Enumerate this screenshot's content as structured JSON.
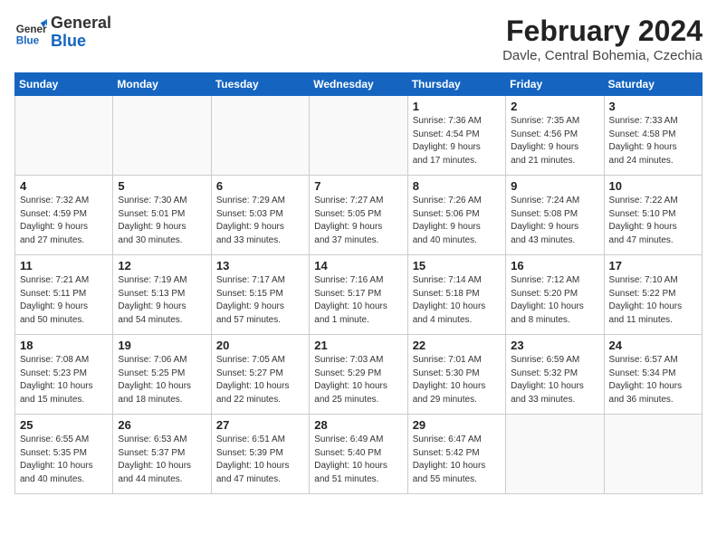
{
  "header": {
    "logo_general": "General",
    "logo_blue": "Blue",
    "month_year": "February 2024",
    "location": "Davle, Central Bohemia, Czechia"
  },
  "weekdays": [
    "Sunday",
    "Monday",
    "Tuesday",
    "Wednesday",
    "Thursday",
    "Friday",
    "Saturday"
  ],
  "weeks": [
    [
      {
        "day": "",
        "info": ""
      },
      {
        "day": "",
        "info": ""
      },
      {
        "day": "",
        "info": ""
      },
      {
        "day": "",
        "info": ""
      },
      {
        "day": "1",
        "info": "Sunrise: 7:36 AM\nSunset: 4:54 PM\nDaylight: 9 hours\nand 17 minutes."
      },
      {
        "day": "2",
        "info": "Sunrise: 7:35 AM\nSunset: 4:56 PM\nDaylight: 9 hours\nand 21 minutes."
      },
      {
        "day": "3",
        "info": "Sunrise: 7:33 AM\nSunset: 4:58 PM\nDaylight: 9 hours\nand 24 minutes."
      }
    ],
    [
      {
        "day": "4",
        "info": "Sunrise: 7:32 AM\nSunset: 4:59 PM\nDaylight: 9 hours\nand 27 minutes."
      },
      {
        "day": "5",
        "info": "Sunrise: 7:30 AM\nSunset: 5:01 PM\nDaylight: 9 hours\nand 30 minutes."
      },
      {
        "day": "6",
        "info": "Sunrise: 7:29 AM\nSunset: 5:03 PM\nDaylight: 9 hours\nand 33 minutes."
      },
      {
        "day": "7",
        "info": "Sunrise: 7:27 AM\nSunset: 5:05 PM\nDaylight: 9 hours\nand 37 minutes."
      },
      {
        "day": "8",
        "info": "Sunrise: 7:26 AM\nSunset: 5:06 PM\nDaylight: 9 hours\nand 40 minutes."
      },
      {
        "day": "9",
        "info": "Sunrise: 7:24 AM\nSunset: 5:08 PM\nDaylight: 9 hours\nand 43 minutes."
      },
      {
        "day": "10",
        "info": "Sunrise: 7:22 AM\nSunset: 5:10 PM\nDaylight: 9 hours\nand 47 minutes."
      }
    ],
    [
      {
        "day": "11",
        "info": "Sunrise: 7:21 AM\nSunset: 5:11 PM\nDaylight: 9 hours\nand 50 minutes."
      },
      {
        "day": "12",
        "info": "Sunrise: 7:19 AM\nSunset: 5:13 PM\nDaylight: 9 hours\nand 54 minutes."
      },
      {
        "day": "13",
        "info": "Sunrise: 7:17 AM\nSunset: 5:15 PM\nDaylight: 9 hours\nand 57 minutes."
      },
      {
        "day": "14",
        "info": "Sunrise: 7:16 AM\nSunset: 5:17 PM\nDaylight: 10 hours\nand 1 minute."
      },
      {
        "day": "15",
        "info": "Sunrise: 7:14 AM\nSunset: 5:18 PM\nDaylight: 10 hours\nand 4 minutes."
      },
      {
        "day": "16",
        "info": "Sunrise: 7:12 AM\nSunset: 5:20 PM\nDaylight: 10 hours\nand 8 minutes."
      },
      {
        "day": "17",
        "info": "Sunrise: 7:10 AM\nSunset: 5:22 PM\nDaylight: 10 hours\nand 11 minutes."
      }
    ],
    [
      {
        "day": "18",
        "info": "Sunrise: 7:08 AM\nSunset: 5:23 PM\nDaylight: 10 hours\nand 15 minutes."
      },
      {
        "day": "19",
        "info": "Sunrise: 7:06 AM\nSunset: 5:25 PM\nDaylight: 10 hours\nand 18 minutes."
      },
      {
        "day": "20",
        "info": "Sunrise: 7:05 AM\nSunset: 5:27 PM\nDaylight: 10 hours\nand 22 minutes."
      },
      {
        "day": "21",
        "info": "Sunrise: 7:03 AM\nSunset: 5:29 PM\nDaylight: 10 hours\nand 25 minutes."
      },
      {
        "day": "22",
        "info": "Sunrise: 7:01 AM\nSunset: 5:30 PM\nDaylight: 10 hours\nand 29 minutes."
      },
      {
        "day": "23",
        "info": "Sunrise: 6:59 AM\nSunset: 5:32 PM\nDaylight: 10 hours\nand 33 minutes."
      },
      {
        "day": "24",
        "info": "Sunrise: 6:57 AM\nSunset: 5:34 PM\nDaylight: 10 hours\nand 36 minutes."
      }
    ],
    [
      {
        "day": "25",
        "info": "Sunrise: 6:55 AM\nSunset: 5:35 PM\nDaylight: 10 hours\nand 40 minutes."
      },
      {
        "day": "26",
        "info": "Sunrise: 6:53 AM\nSunset: 5:37 PM\nDaylight: 10 hours\nand 44 minutes."
      },
      {
        "day": "27",
        "info": "Sunrise: 6:51 AM\nSunset: 5:39 PM\nDaylight: 10 hours\nand 47 minutes."
      },
      {
        "day": "28",
        "info": "Sunrise: 6:49 AM\nSunset: 5:40 PM\nDaylight: 10 hours\nand 51 minutes."
      },
      {
        "day": "29",
        "info": "Sunrise: 6:47 AM\nSunset: 5:42 PM\nDaylight: 10 hours\nand 55 minutes."
      },
      {
        "day": "",
        "info": ""
      },
      {
        "day": "",
        "info": ""
      }
    ]
  ]
}
